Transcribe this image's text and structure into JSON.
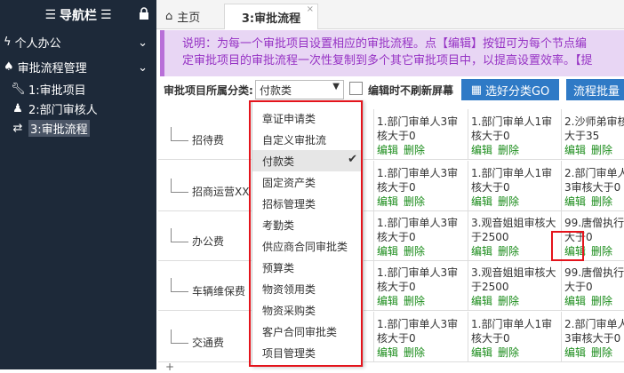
{
  "sidebar": {
    "title": "导航栏",
    "menu_icon": "menu-icon",
    "lock_icon": "lock-icon",
    "groups": [
      {
        "label": "个人办公",
        "icon": "bolt-icon"
      },
      {
        "label": "审批流程管理",
        "icon": "tree-icon"
      }
    ],
    "items": [
      {
        "label": "1:审批项目",
        "icon": "wrench-icon"
      },
      {
        "label": "2:部门审核人",
        "icon": "user-icon"
      },
      {
        "label": "3:审批流程",
        "icon": "exchange-icon",
        "active": true
      }
    ]
  },
  "tabs": [
    {
      "label": "主页",
      "icon": "home-icon"
    },
    {
      "label": "3:审批流程",
      "close": "×"
    }
  ],
  "notice": {
    "line1": "说明：为每一个审批项目设置相应的审批流程。点【编辑】按钮可为每个节点编",
    "line2": "定审批项目的审批流程一次性复制到多个其它审批项目中，以提高设置效率。【提"
  },
  "toolbar": {
    "category_label": "审批项目所属分类:",
    "category_value": "付款类",
    "no_refresh_label": "编辑时不刷新屏幕",
    "go_label": "选好分类GO",
    "batch_label": "流程批量",
    "accent_color": "#2f7ac6"
  },
  "grid": {
    "ops": {
      "edit": "编辑",
      "delete": "删除"
    },
    "rows": [
      {
        "name": "招待费",
        "cells": [
          "1.部门审单人3审核大于0",
          "1.部门审单人1审核大于0",
          "2.沙师弟审核大于35"
        ]
      },
      {
        "name": "招商运营XX",
        "cells": [
          "1.部门审单人3审核大于0",
          "1.部门审单人1审核大于0",
          "2.部门审单人3审核大于0"
        ]
      },
      {
        "name": "办公费",
        "cells": [
          "1.部门审单人3审核大于0",
          "3.观音姐姐审核大于2500",
          "99.唐僧执行大于0"
        ]
      },
      {
        "name": "车辆维保费",
        "cells": [
          "1.部门审单人3审核大于0",
          "3.观音姐姐审核大于2500",
          "99.唐僧执行大于0"
        ]
      },
      {
        "name": "交通费",
        "cells": [
          "1.部门审单人3审核大于0",
          "1.部门审单人1审核大于0",
          "2.部门审单人3审核大于0"
        ]
      }
    ],
    "plus": "+"
  },
  "dropdown": {
    "selected": "付款类",
    "check": "✔",
    "options": [
      "章证申请类",
      "自定义审批流",
      "付款类",
      "固定资产类",
      "招标管理类",
      "考勤类",
      "供应商合同审批类",
      "预算类",
      "物资领用类",
      "物资采购类",
      "客户合同审批类",
      "项目管理类"
    ]
  },
  "colors": {
    "sidebar_bg": "#1d2939",
    "notice_bg": "#e8d6f4",
    "notice_text": "#9632c4",
    "highlight": "#e4141c",
    "ops_green": "#1a8c1a"
  }
}
